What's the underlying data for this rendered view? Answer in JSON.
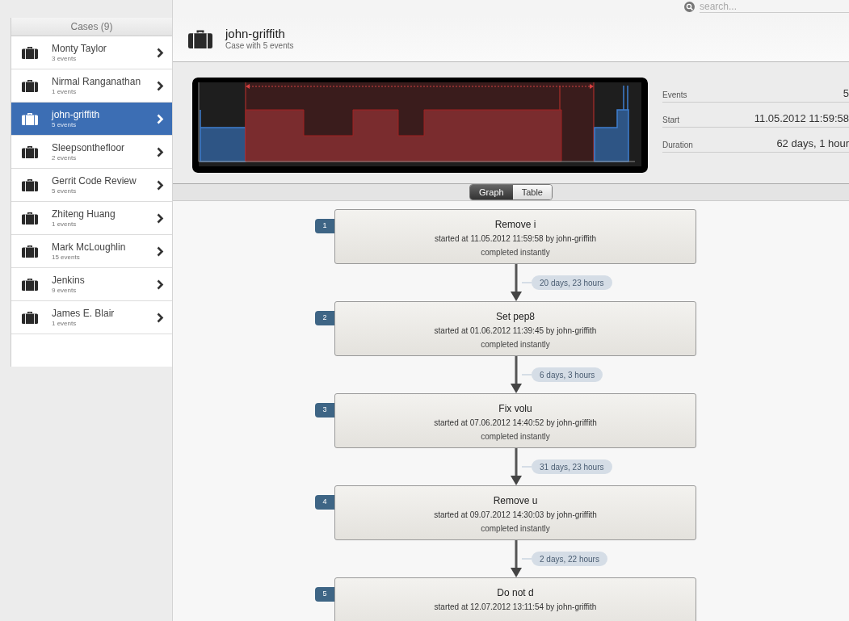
{
  "search": {
    "placeholder": "search..."
  },
  "sidebar": {
    "title": "Cases (9)",
    "items": [
      {
        "name": "Monty Taylor",
        "count": "3 events",
        "selected": false
      },
      {
        "name": "Nirmal Ranganathan",
        "count": "1 events",
        "selected": false
      },
      {
        "name": "john-griffith",
        "count": "5 events",
        "selected": true
      },
      {
        "name": "Sleepsonthefloor",
        "count": "2 events",
        "selected": false
      },
      {
        "name": "Gerrit Code Review",
        "count": "5 events",
        "selected": false
      },
      {
        "name": "Zhiteng Huang",
        "count": "1 events",
        "selected": false
      },
      {
        "name": "Mark McLoughlin",
        "count": "15 events",
        "selected": false
      },
      {
        "name": "Jenkins",
        "count": "9 events",
        "selected": false
      },
      {
        "name": "James E. Blair",
        "count": "1 events",
        "selected": false
      }
    ]
  },
  "case": {
    "title": "john-griffith",
    "subtitle": "Case with 5 events"
  },
  "stats": [
    {
      "label": "Events",
      "value": "5"
    },
    {
      "label": "Start",
      "value": "11.05.2012 11:59:58"
    },
    {
      "label": "Duration",
      "value": "62 days, 1 hour"
    }
  ],
  "view_tabs": [
    {
      "label": "Graph",
      "selected": true
    },
    {
      "label": "Table",
      "selected": false
    }
  ],
  "events": [
    {
      "number": "1",
      "title": "Remove i",
      "started": "started at 11.05.2012 11:59:58 by john-griffith",
      "completion": "completed instantly",
      "gap": "20 days, 23 hours"
    },
    {
      "number": "2",
      "title": "Set pep8",
      "started": "started at 01.06.2012 11:39:45 by john-griffith",
      "completion": "completed instantly",
      "gap": "6 days, 3 hours"
    },
    {
      "number": "3",
      "title": "Fix volu",
      "started": "started at 07.06.2012 14:40:52 by john-griffith",
      "completion": "completed instantly",
      "gap": "31 days, 23 hours"
    },
    {
      "number": "4",
      "title": "Remove u",
      "started": "started at 09.07.2012 14:30:03 by john-griffith",
      "completion": "completed instantly",
      "gap": "2 days, 22 hours"
    },
    {
      "number": "5",
      "title": "Do not d",
      "started": "started at 12.07.2012 13:11:54 by john-griffith"
    }
  ]
}
